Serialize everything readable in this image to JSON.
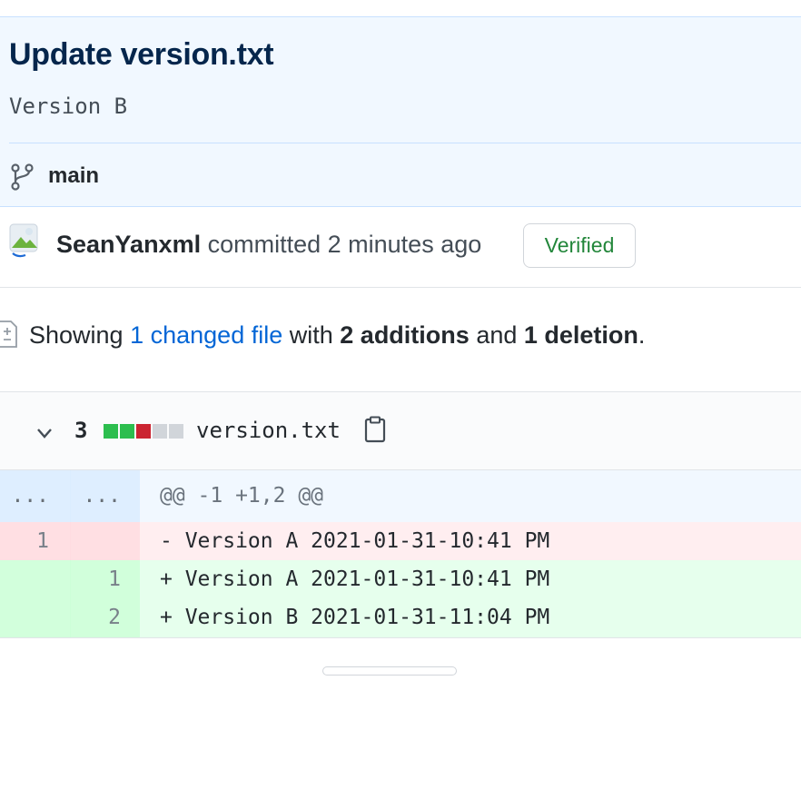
{
  "commit": {
    "title": "Update version.txt",
    "description": "Version B",
    "branch": "main",
    "author": "SeanYanxml",
    "action": "committed 2 minutes ago",
    "verified_label": "Verified"
  },
  "summary": {
    "prefix": "Showing",
    "changed_files_link": "1 changed file",
    "with": "with",
    "additions": "2 additions",
    "and": "and",
    "deletions": "1 deletion",
    "suffix": "."
  },
  "file": {
    "change_count": "3",
    "name": "version.txt",
    "diffstat": [
      "add",
      "add",
      "del",
      "neutral",
      "neutral"
    ]
  },
  "diff": {
    "hunk": {
      "old_num": "...",
      "new_num": "...",
      "header": "@@ -1 +1,2 @@"
    },
    "lines": [
      {
        "type": "del",
        "old": "1",
        "new": "",
        "text": "- Version A 2021-01-31-10:41 PM"
      },
      {
        "type": "add",
        "old": "",
        "new": "1",
        "text": "+ Version A 2021-01-31-10:41 PM"
      },
      {
        "type": "add",
        "old": "",
        "new": "2",
        "text": "+ Version B 2021-01-31-11:04 PM"
      }
    ]
  },
  "icons": {
    "branch": "git-branch-icon",
    "diff": "file-diff-icon",
    "chevron": "chevron-down-icon",
    "copy": "clipboard-icon"
  },
  "colors": {
    "commit_bg": "#f1f8ff",
    "link": "#0366d6",
    "verified": "#22863a",
    "addition": "#2cbe4e",
    "deletion": "#cb2431"
  }
}
